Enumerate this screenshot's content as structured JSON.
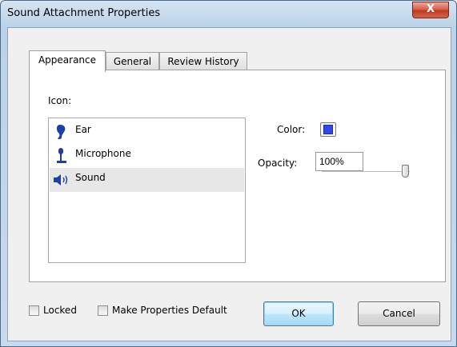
{
  "window": {
    "title": "Sound Attachment Properties",
    "close_glyph": "X"
  },
  "tabs": [
    {
      "label": "Appearance",
      "active": true
    },
    {
      "label": "General",
      "active": false
    },
    {
      "label": "Review History",
      "active": false
    }
  ],
  "appearance": {
    "icon_label": "Icon:",
    "icons": [
      {
        "label": "Ear",
        "icon": "ear-icon",
        "selected": false
      },
      {
        "label": "Microphone",
        "icon": "microphone-icon",
        "selected": false
      },
      {
        "label": "Sound",
        "icon": "speaker-icon",
        "selected": true
      }
    ],
    "color_label": "Color:",
    "color_value": "#3347e8",
    "opacity_label": "Opacity:",
    "opacity_value": "100%",
    "opacity_slider_fraction": 1.0
  },
  "footer": {
    "locked_label": "Locked",
    "locked_checked": false,
    "make_default_label": "Make Properties Default",
    "make_default_checked": false,
    "ok_label": "OK",
    "cancel_label": "Cancel"
  }
}
